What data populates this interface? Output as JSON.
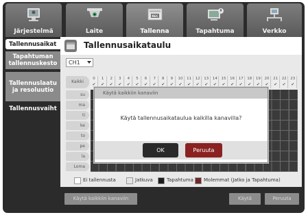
{
  "nav": {
    "tabs": [
      {
        "label": "Järjestelmä",
        "icon": "monitor-icon"
      },
      {
        "label": "Laite",
        "icon": "camera-icon"
      },
      {
        "label": "Tallenna",
        "icon": "record-icon"
      },
      {
        "label": "Tapahtuma",
        "icon": "event-icon"
      },
      {
        "label": "Verkko",
        "icon": "network-icon"
      }
    ],
    "active_tab": "Tallenna"
  },
  "sidebar": {
    "items": [
      {
        "label": "Tallennusaikat"
      },
      {
        "label": "Tapahtuman tallennuskesto"
      },
      {
        "label": "Tallennuslaatu ja resoluutio"
      },
      {
        "label": "Tallennusvaiht"
      }
    ]
  },
  "page": {
    "title": "Tallennusaikataulu",
    "channel_select": "CH1"
  },
  "grid": {
    "day_header": "Kaikki",
    "hours": [
      "0",
      "1",
      "2",
      "3",
      "4",
      "5",
      "6",
      "7",
      "8",
      "9",
      "10",
      "11",
      "12",
      "13",
      "14",
      "15",
      "16",
      "17",
      "18",
      "19",
      "20",
      "21",
      "22",
      "23"
    ],
    "days": [
      "su",
      "ma",
      "ti",
      "ke",
      "to",
      "pe",
      "la",
      "Loma"
    ]
  },
  "legend": {
    "items": [
      {
        "label": "Ei tallennusta",
        "color": "#ffffff"
      },
      {
        "label": "Jatkuva",
        "color": "#e4e4e4"
      },
      {
        "label": "Tapahtuma",
        "color": "#1e1e1e"
      },
      {
        "label": "Molemmat (Jatko ja Tapahtuma)",
        "color": "#6e2a2a"
      }
    ]
  },
  "buttons": {
    "apply_all": "Käytä kaikkiin kanaviin",
    "apply": "Käytä",
    "cancel": "Peruuta"
  },
  "modal": {
    "title": "Käytä kaikkiin kanaviin",
    "message": "Käytä tallennusaikataulua kaikilla kanavilla?",
    "ok": "OK",
    "cancel": "Peruuta"
  },
  "colors": {
    "nav_gradient_top": "#7d7d7d",
    "panel_bg": "#e9e9e9",
    "grid_cell": "#3a3a3a",
    "ok_button": "#2a2a2a",
    "cancel_button": "#8a2222"
  }
}
